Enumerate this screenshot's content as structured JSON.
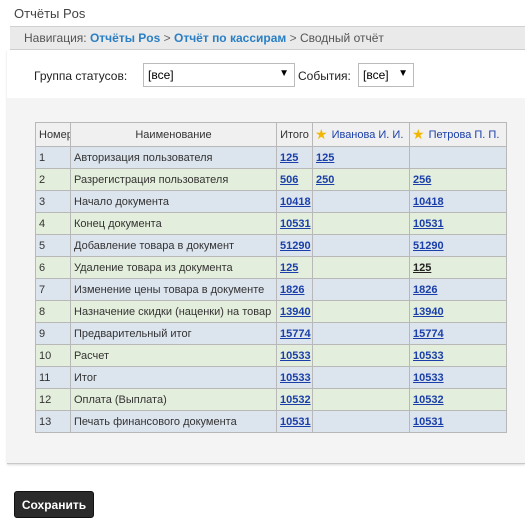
{
  "window": {
    "title": "Отчёты Pos"
  },
  "breadcrumb": {
    "prefix": "Навигация:",
    "items": [
      "Отчёты Pos",
      "Отчёт по кассирам"
    ],
    "separator": ">",
    "current": "Сводный отчёт"
  },
  "filters": {
    "status_group": {
      "label": "Группа статусов:",
      "value": "[все]"
    },
    "events": {
      "label": "События:",
      "value": "[все]"
    }
  },
  "table": {
    "headers": [
      "Номер",
      "Наименование",
      "Итого",
      "Иванова И. И.",
      "Петрова П. П."
    ],
    "rows": [
      [
        "1",
        "Авторизация пользователя",
        "125",
        "125",
        ""
      ],
      [
        "2",
        "Разрегистрация пользователя",
        "506",
        "250",
        "256"
      ],
      [
        "3",
        "Начало документа",
        "10418",
        "",
        "10418"
      ],
      [
        "4",
        "Конец документа",
        "10531",
        "",
        "10531"
      ],
      [
        "5",
        "Добавление товара в документ",
        "51290",
        "",
        "51290"
      ],
      [
        "6",
        "Удаление товара из документа",
        "125",
        "",
        "125"
      ],
      [
        "7",
        "Изменение цены товара в документе",
        "1826",
        "",
        "1826"
      ],
      [
        "8",
        "Назначение скидки (наценки) на товар",
        "13940",
        "",
        "13940"
      ],
      [
        "9",
        "Предварительный итог",
        "15774",
        "",
        "15774"
      ],
      [
        "10",
        "Расчет",
        "10533",
        "",
        "10533"
      ],
      [
        "11",
        "Итог",
        "10533",
        "",
        "10533"
      ],
      [
        "12",
        "Оплата (Выплата)",
        "10532",
        "",
        "10532"
      ],
      [
        "13",
        "Печать финансового документа",
        "10531",
        "",
        "10531"
      ]
    ]
  },
  "actions": {
    "save_label": "Сохранить"
  },
  "colors": {
    "link": "#1a3fa8",
    "breadcrumb_link": "#2a7fc4",
    "row_odd": "#dce4ee",
    "row_even": "#e4eedc",
    "star": "#f2b705"
  },
  "icons": {
    "cashier_header": "star-icon",
    "select": "chevron-down-icon"
  }
}
